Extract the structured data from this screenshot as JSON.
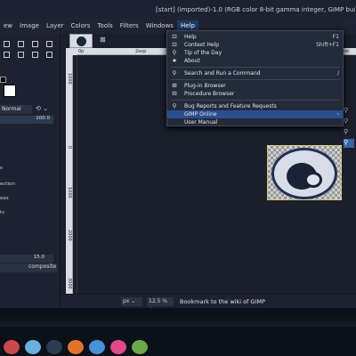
{
  "window": {
    "title": "[start] (imported)-1.0 (RGB color 8-bit gamma integer, GIMP bui"
  },
  "menubar": {
    "items": [
      "ew",
      "Image",
      "Layer",
      "Colors",
      "Tools",
      "Filters",
      "Windows",
      "Help"
    ]
  },
  "toolbox": {
    "mode": "Normal",
    "opacity": "100.0",
    "labels": [
      "s",
      "ection",
      "eas",
      "ts"
    ],
    "size_value": "15.0",
    "composite": "composite"
  },
  "rulers": {
    "h_labels": [
      "0p",
      "2oop",
      "oo"
    ],
    "v_labels": [
      "1000",
      "0",
      "1000",
      "2000",
      "3000"
    ]
  },
  "statusbar": {
    "unit": "px",
    "zoom": "12.5 %",
    "message": "Bookmark to the wiki of GIMP"
  },
  "help_menu": {
    "items": [
      {
        "icon": "help-icon",
        "glyph": "⊡",
        "label": "Help",
        "shortcut": "F1"
      },
      {
        "icon": "context-help-icon",
        "glyph": "⊡",
        "label": "Context Help",
        "shortcut": "Shift+F1"
      },
      {
        "icon": "tip-icon",
        "glyph": "⚲",
        "label": "Tip of the Day",
        "shortcut": ""
      },
      {
        "icon": "about-icon",
        "glyph": "★",
        "label": "About",
        "shortcut": ""
      },
      {
        "icon": "search-icon",
        "glyph": "⚲",
        "label": "Search and Run a Command",
        "shortcut": "/"
      },
      {
        "icon": "plugin-icon",
        "glyph": "⊞",
        "label": "Plug-in Browser",
        "shortcut": ""
      },
      {
        "icon": "procedure-icon",
        "glyph": "⊟",
        "label": "Procedure Browser",
        "shortcut": ""
      },
      {
        "icon": "bug-icon",
        "glyph": "⚲",
        "label": "Bug Reports and Feature Requests",
        "shortcut": ""
      },
      {
        "icon": "",
        "glyph": "",
        "label": "GIMP Online",
        "shortcut": "›"
      },
      {
        "icon": "",
        "glyph": "",
        "label": "User Manual",
        "shortcut": "›"
      }
    ]
  },
  "colors": {
    "accent": "#2a4f8f",
    "menu_bg": "#232a38"
  }
}
